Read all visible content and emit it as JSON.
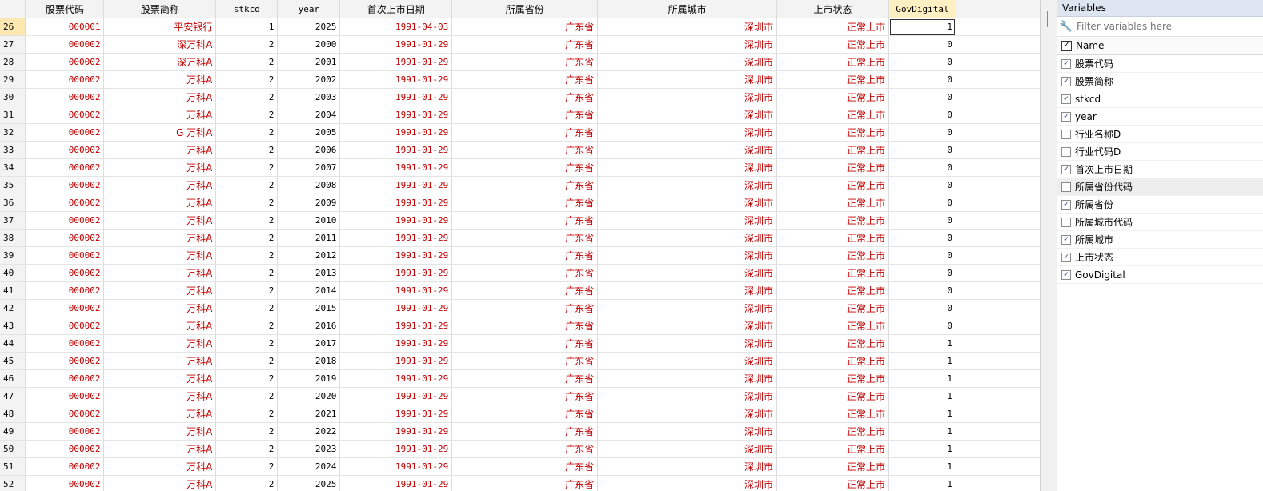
{
  "grid": {
    "columns": [
      "",
      "股票代码",
      "股票简称",
      "stkcd",
      "year",
      "首次上市日期",
      "所属省份",
      "所属城市",
      "上市状态",
      "GovDigital"
    ],
    "rows": [
      {
        "n": "26",
        "code": "000001",
        "name": "平安银行",
        "stkcd": "1",
        "year": "2025",
        "date": "1991-04-03",
        "prov": "广东省",
        "city": "深圳市",
        "status": "正常上市",
        "gov": "1"
      },
      {
        "n": "27",
        "code": "000002",
        "name": "深万科A",
        "stkcd": "2",
        "year": "2000",
        "date": "1991-01-29",
        "prov": "广东省",
        "city": "深圳市",
        "status": "正常上市",
        "gov": "0"
      },
      {
        "n": "28",
        "code": "000002",
        "name": "深万科A",
        "stkcd": "2",
        "year": "2001",
        "date": "1991-01-29",
        "prov": "广东省",
        "city": "深圳市",
        "status": "正常上市",
        "gov": "0"
      },
      {
        "n": "29",
        "code": "000002",
        "name": "万科A",
        "stkcd": "2",
        "year": "2002",
        "date": "1991-01-29",
        "prov": "广东省",
        "city": "深圳市",
        "status": "正常上市",
        "gov": "0"
      },
      {
        "n": "30",
        "code": "000002",
        "name": "万科A",
        "stkcd": "2",
        "year": "2003",
        "date": "1991-01-29",
        "prov": "广东省",
        "city": "深圳市",
        "status": "正常上市",
        "gov": "0"
      },
      {
        "n": "31",
        "code": "000002",
        "name": "万科A",
        "stkcd": "2",
        "year": "2004",
        "date": "1991-01-29",
        "prov": "广东省",
        "city": "深圳市",
        "status": "正常上市",
        "gov": "0"
      },
      {
        "n": "32",
        "code": "000002",
        "name": "G 万科A",
        "stkcd": "2",
        "year": "2005",
        "date": "1991-01-29",
        "prov": "广东省",
        "city": "深圳市",
        "status": "正常上市",
        "gov": "0"
      },
      {
        "n": "33",
        "code": "000002",
        "name": "万科A",
        "stkcd": "2",
        "year": "2006",
        "date": "1991-01-29",
        "prov": "广东省",
        "city": "深圳市",
        "status": "正常上市",
        "gov": "0"
      },
      {
        "n": "34",
        "code": "000002",
        "name": "万科A",
        "stkcd": "2",
        "year": "2007",
        "date": "1991-01-29",
        "prov": "广东省",
        "city": "深圳市",
        "status": "正常上市",
        "gov": "0"
      },
      {
        "n": "35",
        "code": "000002",
        "name": "万科A",
        "stkcd": "2",
        "year": "2008",
        "date": "1991-01-29",
        "prov": "广东省",
        "city": "深圳市",
        "status": "正常上市",
        "gov": "0"
      },
      {
        "n": "36",
        "code": "000002",
        "name": "万科A",
        "stkcd": "2",
        "year": "2009",
        "date": "1991-01-29",
        "prov": "广东省",
        "city": "深圳市",
        "status": "正常上市",
        "gov": "0"
      },
      {
        "n": "37",
        "code": "000002",
        "name": "万科A",
        "stkcd": "2",
        "year": "2010",
        "date": "1991-01-29",
        "prov": "广东省",
        "city": "深圳市",
        "status": "正常上市",
        "gov": "0"
      },
      {
        "n": "38",
        "code": "000002",
        "name": "万科A",
        "stkcd": "2",
        "year": "2011",
        "date": "1991-01-29",
        "prov": "广东省",
        "city": "深圳市",
        "status": "正常上市",
        "gov": "0"
      },
      {
        "n": "39",
        "code": "000002",
        "name": "万科A",
        "stkcd": "2",
        "year": "2012",
        "date": "1991-01-29",
        "prov": "广东省",
        "city": "深圳市",
        "status": "正常上市",
        "gov": "0"
      },
      {
        "n": "40",
        "code": "000002",
        "name": "万科A",
        "stkcd": "2",
        "year": "2013",
        "date": "1991-01-29",
        "prov": "广东省",
        "city": "深圳市",
        "status": "正常上市",
        "gov": "0"
      },
      {
        "n": "41",
        "code": "000002",
        "name": "万科A",
        "stkcd": "2",
        "year": "2014",
        "date": "1991-01-29",
        "prov": "广东省",
        "city": "深圳市",
        "status": "正常上市",
        "gov": "0"
      },
      {
        "n": "42",
        "code": "000002",
        "name": "万科A",
        "stkcd": "2",
        "year": "2015",
        "date": "1991-01-29",
        "prov": "广东省",
        "city": "深圳市",
        "status": "正常上市",
        "gov": "0"
      },
      {
        "n": "43",
        "code": "000002",
        "name": "万科A",
        "stkcd": "2",
        "year": "2016",
        "date": "1991-01-29",
        "prov": "广东省",
        "city": "深圳市",
        "status": "正常上市",
        "gov": "0"
      },
      {
        "n": "44",
        "code": "000002",
        "name": "万科A",
        "stkcd": "2",
        "year": "2017",
        "date": "1991-01-29",
        "prov": "广东省",
        "city": "深圳市",
        "status": "正常上市",
        "gov": "1"
      },
      {
        "n": "45",
        "code": "000002",
        "name": "万科A",
        "stkcd": "2",
        "year": "2018",
        "date": "1991-01-29",
        "prov": "广东省",
        "city": "深圳市",
        "status": "正常上市",
        "gov": "1"
      },
      {
        "n": "46",
        "code": "000002",
        "name": "万科A",
        "stkcd": "2",
        "year": "2019",
        "date": "1991-01-29",
        "prov": "广东省",
        "city": "深圳市",
        "status": "正常上市",
        "gov": "1"
      },
      {
        "n": "47",
        "code": "000002",
        "name": "万科A",
        "stkcd": "2",
        "year": "2020",
        "date": "1991-01-29",
        "prov": "广东省",
        "city": "深圳市",
        "status": "正常上市",
        "gov": "1"
      },
      {
        "n": "48",
        "code": "000002",
        "name": "万科A",
        "stkcd": "2",
        "year": "2021",
        "date": "1991-01-29",
        "prov": "广东省",
        "city": "深圳市",
        "status": "正常上市",
        "gov": "1"
      },
      {
        "n": "49",
        "code": "000002",
        "name": "万科A",
        "stkcd": "2",
        "year": "2022",
        "date": "1991-01-29",
        "prov": "广东省",
        "city": "深圳市",
        "status": "正常上市",
        "gov": "1"
      },
      {
        "n": "50",
        "code": "000002",
        "name": "万科A",
        "stkcd": "2",
        "year": "2023",
        "date": "1991-01-29",
        "prov": "广东省",
        "city": "深圳市",
        "status": "正常上市",
        "gov": "1"
      },
      {
        "n": "51",
        "code": "000002",
        "name": "万科A",
        "stkcd": "2",
        "year": "2024",
        "date": "1991-01-29",
        "prov": "广东省",
        "city": "深圳市",
        "status": "正常上市",
        "gov": "1"
      },
      {
        "n": "52",
        "code": "000002",
        "name": "万科A",
        "stkcd": "2",
        "year": "2025",
        "date": "1991-01-29",
        "prov": "广东省",
        "city": "深圳市",
        "status": "正常上市",
        "gov": "1"
      }
    ]
  },
  "variables_panel": {
    "title": "Variables",
    "filter_placeholder": "Filter variables here",
    "name_header": "Name",
    "items": [
      {
        "label": "股票代码",
        "checked": true
      },
      {
        "label": "股票简称",
        "checked": true
      },
      {
        "label": "stkcd",
        "checked": true
      },
      {
        "label": "year",
        "checked": true
      },
      {
        "label": "行业名称D",
        "checked": false
      },
      {
        "label": "行业代码D",
        "checked": false
      },
      {
        "label": "首次上市日期",
        "checked": true
      },
      {
        "label": "所属省份代码",
        "checked": false
      },
      {
        "label": "所属省份",
        "checked": true
      },
      {
        "label": "所属城市代码",
        "checked": false
      },
      {
        "label": "所属城市",
        "checked": true
      },
      {
        "label": "上市状态",
        "checked": true
      },
      {
        "label": "GovDigital",
        "checked": true
      }
    ]
  },
  "colors": {
    "string_value": "#c00000",
    "selected_header": "#fff0c4",
    "panel_title_bg": "#dde6f0"
  },
  "icons": {
    "filter": "wrench-icon",
    "checkbox": "check-icon"
  }
}
